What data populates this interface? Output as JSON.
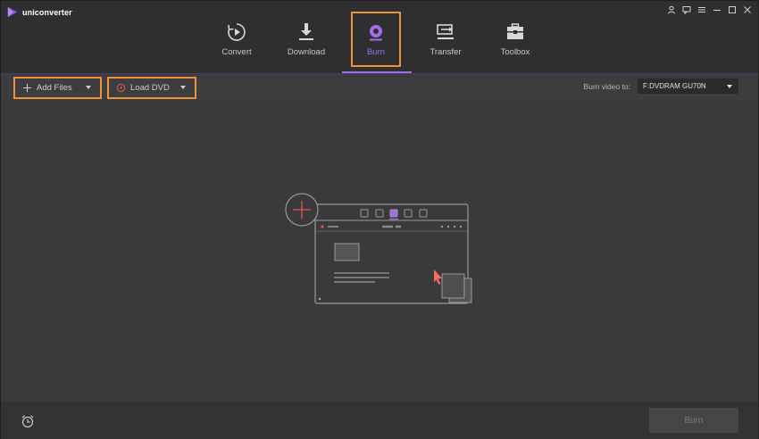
{
  "app": {
    "name": "uniconverter"
  },
  "nav": {
    "tabs": [
      {
        "id": "convert",
        "label": "Convert",
        "icon": "convert-icon"
      },
      {
        "id": "download",
        "label": "Download",
        "icon": "download-icon"
      },
      {
        "id": "burn",
        "label": "Burn",
        "icon": "burn-icon",
        "active": true
      },
      {
        "id": "transfer",
        "label": "Transfer",
        "icon": "transfer-icon"
      },
      {
        "id": "toolbox",
        "label": "Toolbox",
        "icon": "toolbox-icon"
      }
    ]
  },
  "window_controls": [
    "user-icon",
    "feedback-icon",
    "menu-icon",
    "minimize-icon",
    "maximize-icon",
    "close-icon"
  ],
  "toolbar": {
    "add_files_label": "Add Files",
    "load_dvd_label": "Load DVD",
    "burn_to_label": "Burn video to:",
    "burn_to_value": "F:DVDRAM GU70N"
  },
  "footer": {
    "burn_label": "Burn",
    "schedule_icon": "alarm-clock-icon"
  },
  "colors": {
    "accent": "#a26de8",
    "highlight": "#f0923a",
    "background": "#3a393b",
    "cursor": "#ff6a5a"
  }
}
